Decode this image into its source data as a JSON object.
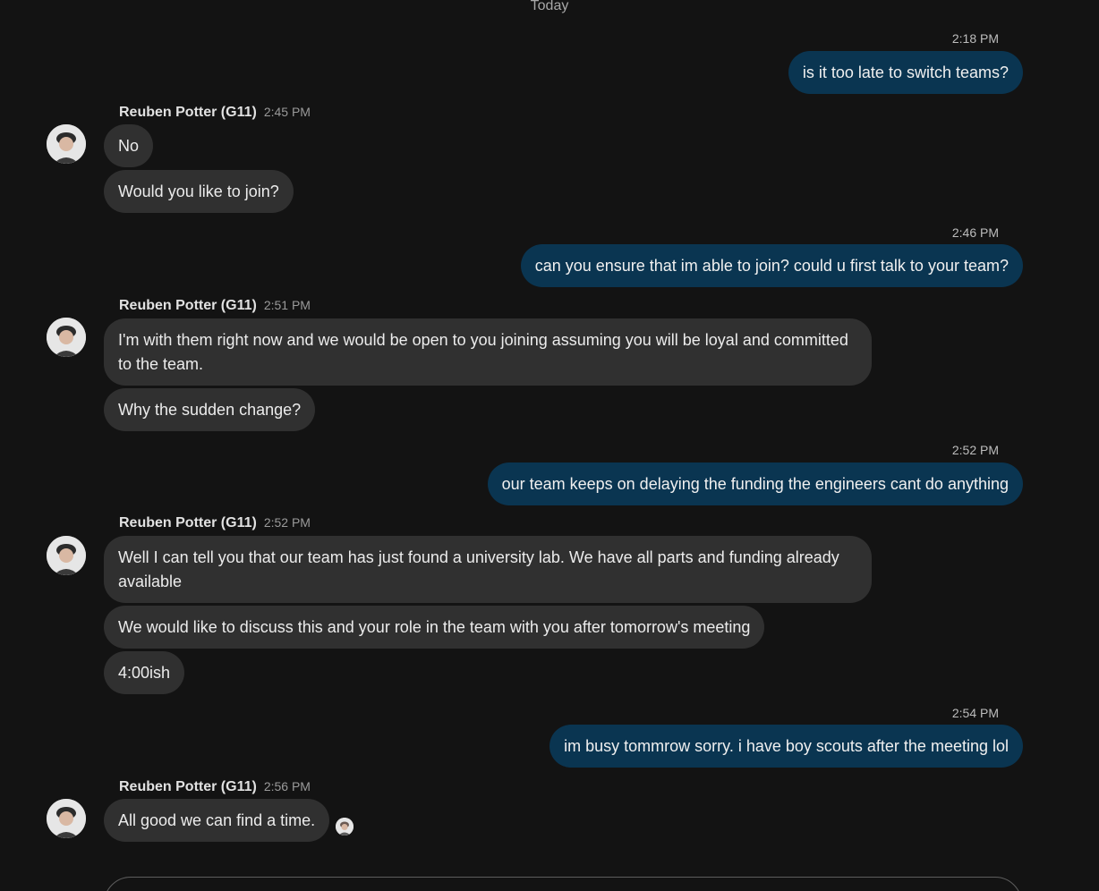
{
  "divider": {
    "label": "Today"
  },
  "sender": {
    "name": "Reuben Potter (G11)"
  },
  "messages": {
    "m1": {
      "time": "2:18 PM",
      "text": "is it too late to switch teams?"
    },
    "g1": {
      "time": "2:45 PM",
      "lines": [
        "No",
        "Would you like to join?"
      ]
    },
    "m2": {
      "time": "2:46 PM",
      "text": "can you ensure that im able to join? could u first talk to your team?"
    },
    "g2": {
      "time": "2:51 PM",
      "lines": [
        "I'm with them right now and we would be open to you joining assuming you will be loyal and committed to the team.",
        "Why the sudden change?"
      ]
    },
    "m3": {
      "time": "2:52 PM",
      "text": "our team keeps on delaying the funding the engineers cant do anything"
    },
    "g3": {
      "time": "2:52 PM",
      "lines": [
        "Well I can tell you that our team has just found a university lab. We have all parts and funding already available",
        "We would like to discuss this and your role in the team with you after tomorrow's meeting",
        "4:00ish"
      ]
    },
    "m4": {
      "time": "2:54 PM",
      "text": "im busy tommrow sorry. i have boy scouts after the meeting lol"
    },
    "g4": {
      "time": "2:56 PM",
      "lines": [
        "All good we can find a time."
      ]
    }
  },
  "colors": {
    "background": "#131313",
    "outgoing_bubble": "#0a3551",
    "incoming_bubble": "#303030",
    "composer_border": "#5e5e5e"
  },
  "icons": {
    "avatar": "person-avatar-icon",
    "read_receipt": "read-receipt-avatar-icon"
  }
}
